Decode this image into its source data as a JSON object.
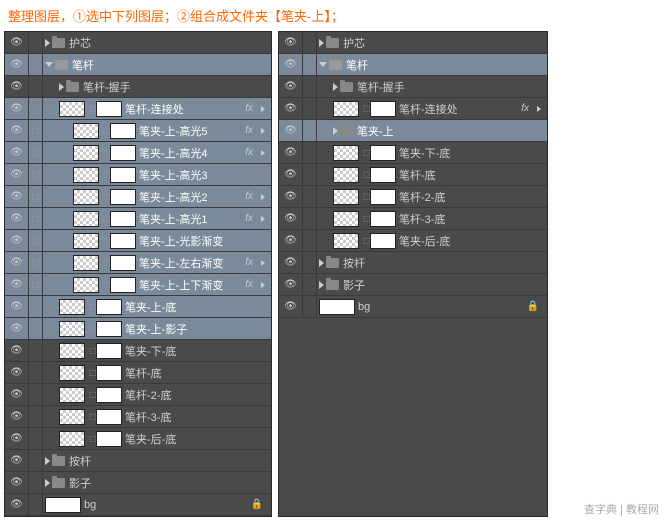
{
  "instruction": "整理图层，①选中下列图层；②组合成文件夹【笔夹-上】；",
  "watermark": "查字典 | 教程网",
  "eye_glyph": "👁",
  "fx_label": "fx",
  "link_glyph": "⬚",
  "lock_glyph": "🔒",
  "left_panel": {
    "rows": [
      {
        "type": "folder",
        "label": "护芯",
        "indent": 0,
        "vis": true,
        "arrow": "right",
        "sel": false
      },
      {
        "type": "folder",
        "label": "笔杆",
        "indent": 0,
        "vis": true,
        "arrow": "down",
        "sel": true,
        "open": true
      },
      {
        "type": "folder",
        "label": "笔杆-握手",
        "indent": 1,
        "vis": true,
        "arrow": "right",
        "sel": false
      },
      {
        "type": "layer",
        "label": "笔杆-连接处",
        "indent": 1,
        "vis": true,
        "sel": true,
        "fx": true,
        "thumbs": [
          "checker",
          "mask"
        ]
      },
      {
        "type": "layer",
        "label": "笔夹-上-高光5",
        "indent": 2,
        "vis": true,
        "sel": true,
        "fx": true,
        "link": true,
        "thumbs": [
          "checker",
          "mask"
        ]
      },
      {
        "type": "layer",
        "label": "笔夹-上-高光4",
        "indent": 2,
        "vis": true,
        "sel": true,
        "fx": true,
        "link": true,
        "thumbs": [
          "checker",
          "mask"
        ]
      },
      {
        "type": "layer",
        "label": "笔夹-上-高光3",
        "indent": 2,
        "vis": true,
        "sel": true,
        "dot2": true,
        "link": true,
        "thumbs": [
          "checker",
          "mask"
        ]
      },
      {
        "type": "layer",
        "label": "笔夹-上-高光2",
        "indent": 2,
        "vis": true,
        "sel": true,
        "fx": true,
        "link": true,
        "thumbs": [
          "checker",
          "mask"
        ]
      },
      {
        "type": "layer",
        "label": "笔夹-上-高光1",
        "indent": 2,
        "vis": true,
        "sel": true,
        "fx": true,
        "link": true,
        "thumbs": [
          "checker",
          "mask"
        ]
      },
      {
        "type": "layer",
        "label": "笔夹-上-光影渐变",
        "indent": 2,
        "vis": true,
        "sel": true,
        "link": true,
        "thumbs": [
          "checker",
          "mask"
        ]
      },
      {
        "type": "layer",
        "label": "笔夹-上-左右渐变",
        "indent": 2,
        "vis": true,
        "sel": true,
        "fx": true,
        "link": true,
        "thumbs": [
          "checker",
          "mask"
        ]
      },
      {
        "type": "layer",
        "label": "笔夹-上-上下渐变",
        "indent": 2,
        "vis": true,
        "sel": true,
        "fx": true,
        "link": true,
        "thumbs": [
          "checker",
          "mask"
        ]
      },
      {
        "type": "layer",
        "label": "笔夹-上-底",
        "indent": 1,
        "vis": true,
        "sel": true,
        "thumbs": [
          "checker",
          "mask"
        ]
      },
      {
        "type": "layer",
        "label": "笔夹-上-影子",
        "indent": 1,
        "vis": true,
        "sel": true,
        "thumbs": [
          "checker",
          "mask"
        ]
      },
      {
        "type": "layer",
        "label": "笔夹-下-底",
        "indent": 1,
        "vis": true,
        "sel": false,
        "thumbs": [
          "checker",
          "mask"
        ]
      },
      {
        "type": "layer",
        "label": "笔杆-底",
        "indent": 1,
        "vis": true,
        "sel": false,
        "thumbs": [
          "checker",
          "mask"
        ]
      },
      {
        "type": "layer",
        "label": "笔杆-2-底",
        "indent": 1,
        "vis": true,
        "sel": false,
        "thumbs": [
          "checker",
          "mask"
        ]
      },
      {
        "type": "layer",
        "label": "笔杆-3-底",
        "indent": 1,
        "vis": true,
        "sel": false,
        "thumbs": [
          "checker",
          "mask"
        ]
      },
      {
        "type": "layer",
        "label": "笔夹-后-底",
        "indent": 1,
        "vis": true,
        "sel": false,
        "thumbs": [
          "checker",
          "mask"
        ]
      },
      {
        "type": "folder",
        "label": "按杆",
        "indent": 0,
        "vis": true,
        "arrow": "right",
        "sel": false
      },
      {
        "type": "folder",
        "label": "影子",
        "indent": 0,
        "vis": true,
        "arrow": "right",
        "sel": false
      },
      {
        "type": "bg",
        "label": "bg",
        "indent": 0,
        "vis": true,
        "sel": false,
        "lock": true
      }
    ]
  },
  "right_panel": {
    "rows": [
      {
        "type": "folder",
        "label": "护芯",
        "indent": 0,
        "vis": true,
        "arrow": "right",
        "sel": false
      },
      {
        "type": "folder",
        "label": "笔杆",
        "indent": 0,
        "vis": true,
        "arrow": "down",
        "sel": true,
        "open": true
      },
      {
        "type": "folder",
        "label": "笔杆-握手",
        "indent": 1,
        "vis": true,
        "arrow": "right",
        "sel": false
      },
      {
        "type": "layer",
        "label": "笔杆-连接处",
        "indent": 1,
        "vis": true,
        "sel": false,
        "fx": true,
        "thumbs": [
          "checker",
          "mask"
        ]
      },
      {
        "type": "folder",
        "label": "笔夹-上",
        "indent": 1,
        "vis": true,
        "arrow": "right",
        "sel": true
      },
      {
        "type": "layer",
        "label": "笔夹-下-底",
        "indent": 1,
        "vis": true,
        "sel": false,
        "thumbs": [
          "checker",
          "mask"
        ]
      },
      {
        "type": "layer",
        "label": "笔杆-底",
        "indent": 1,
        "vis": true,
        "sel": false,
        "thumbs": [
          "checker",
          "mask"
        ]
      },
      {
        "type": "layer",
        "label": "笔杆-2-底",
        "indent": 1,
        "vis": true,
        "sel": false,
        "thumbs": [
          "checker",
          "mask"
        ]
      },
      {
        "type": "layer",
        "label": "笔杆-3-底",
        "indent": 1,
        "vis": true,
        "sel": false,
        "thumbs": [
          "checker",
          "mask"
        ]
      },
      {
        "type": "layer",
        "label": "笔夹-后-底",
        "indent": 1,
        "vis": true,
        "sel": false,
        "thumbs": [
          "checker",
          "mask"
        ]
      },
      {
        "type": "folder",
        "label": "按杆",
        "indent": 0,
        "vis": true,
        "arrow": "right",
        "sel": false
      },
      {
        "type": "folder",
        "label": "影子",
        "indent": 0,
        "vis": true,
        "arrow": "right",
        "sel": false
      },
      {
        "type": "bg",
        "label": "bg",
        "indent": 0,
        "vis": true,
        "sel": false,
        "lock": true
      }
    ]
  }
}
